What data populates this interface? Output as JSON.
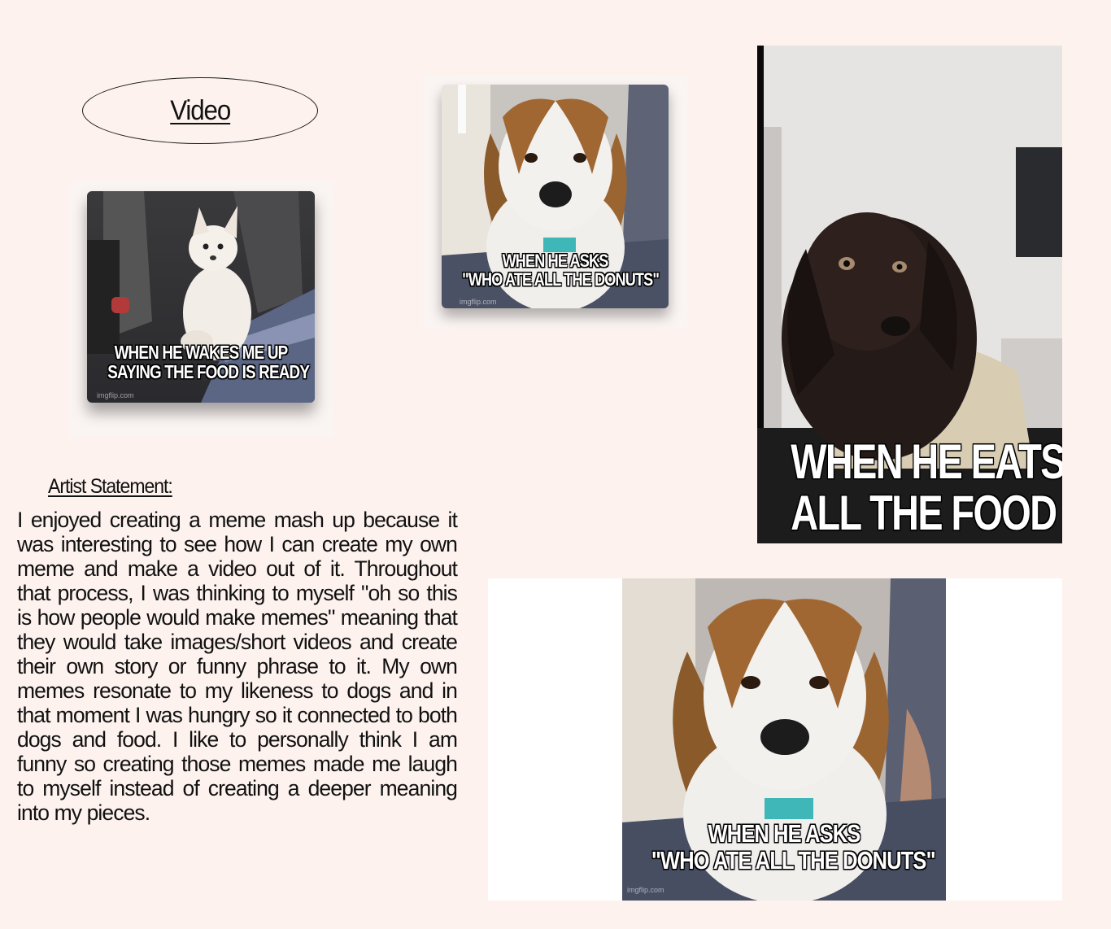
{
  "video_link": {
    "label": "Video"
  },
  "memes": [
    {
      "name": "chihuahua",
      "lines": [
        "WHEN HE WAKES ME UP",
        "SAYING THE FOOD IS READY"
      ],
      "watermark": "imgflip.com"
    },
    {
      "name": "beagle-small",
      "lines": [
        "WHEN HE ASKS",
        "\"WHO ATE ALL THE DONUTS\""
      ],
      "watermark": "imgflip.com"
    },
    {
      "name": "black-dog",
      "lines": [
        "WHEN HE EATS",
        "ALL THE FOOD"
      ]
    },
    {
      "name": "beagle-large",
      "lines": [
        "WHEN HE ASKS",
        "\"WHO ATE ALL THE DONUTS\""
      ],
      "watermark": "imgflip.com"
    }
  ],
  "artist_statement": {
    "heading": "Artist Statement:",
    "body": "I enjoyed creating a meme mash up because it was interesting to see how I can create my own meme and make a video out of it. Throughout that process, I was thinking to myself \"oh so this is how people would make memes\" meaning that they would take images/short videos and create their own story or funny phrase to it. My own memes resonate to my likeness to dogs and in that moment I was hungry so it connected to both dogs and food. I like to personally think I am funny so creating those memes made me laugh to myself instead of creating a deeper meaning into my pieces."
  }
}
